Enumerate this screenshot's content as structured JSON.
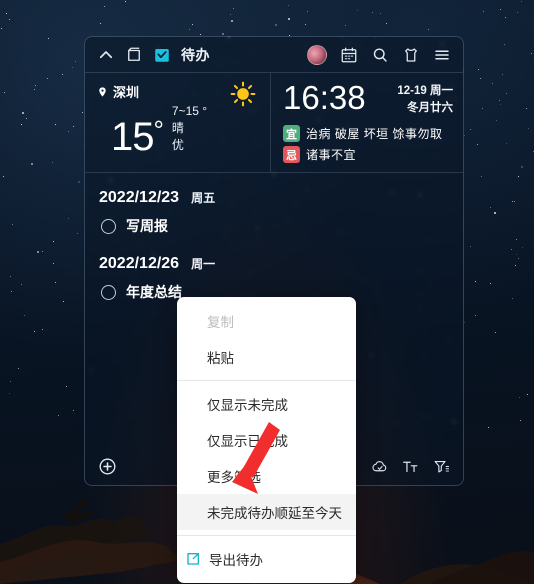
{
  "widget": {
    "topbar": {
      "collapse_icon": "chevron-up-icon",
      "window_icon": "window-pin-icon",
      "app_icon": "todo-checkbox-icon",
      "title": "待办",
      "avatar": "user-avatar",
      "calendar_icon": "calendar-icon",
      "search_icon": "search-icon",
      "skin_icon": "skin-shirt-icon",
      "menu_icon": "hamburger-menu-icon"
    },
    "weather": {
      "location_icon": "location-pin-icon",
      "city": "深圳",
      "condition_icon": "sun-icon",
      "temperature": "15",
      "degree_symbol": "°",
      "range": "7~15 °",
      "condition": "晴",
      "air_quality": "优"
    },
    "datetime": {
      "time": "16:38",
      "date": "12-19  周一",
      "lunar": "冬月廿六",
      "almanac": [
        {
          "badge": "宜",
          "badge_color": "#4caf7d",
          "text": "治病  破屋  坏垣  馀事勿取"
        },
        {
          "badge": "忌",
          "badge_color": "#e2575c",
          "text": "诸事不宜"
        }
      ]
    },
    "tasks": [
      {
        "date": "2022/12/23",
        "weekday": "周五",
        "items": [
          {
            "label": "写周报",
            "done": false
          }
        ]
      },
      {
        "date": "2022/12/26",
        "weekday": "周一",
        "items": [
          {
            "label": "年度总结",
            "done": false
          }
        ]
      }
    ],
    "bottombar": {
      "add_icon": "add-circle-icon",
      "tools": [
        {
          "icon": "save-disk-icon"
        },
        {
          "icon": "cloud-sync-icon"
        },
        {
          "icon": "text-format-icon"
        },
        {
          "icon": "filter-icon"
        }
      ]
    }
  },
  "context_menu": {
    "items": [
      {
        "label": "复制",
        "state": "disabled",
        "icon": null
      },
      {
        "label": "粘贴",
        "state": "normal",
        "icon": null
      },
      {
        "separator_after": true
      },
      {
        "label": "仅显示未完成",
        "state": "normal",
        "icon": null
      },
      {
        "label": "仅显示已完成",
        "state": "normal",
        "icon": null
      },
      {
        "label": "更多筛选",
        "state": "normal",
        "icon": null
      },
      {
        "label": "未完成待办顺延至今天",
        "state": "highlight",
        "icon": null
      },
      {
        "separator_after": true
      },
      {
        "label": "导出待办",
        "state": "normal",
        "icon": "export-icon"
      }
    ]
  },
  "annotation": {
    "arrow": "red-pointer-arrow",
    "color": "#f03030"
  }
}
